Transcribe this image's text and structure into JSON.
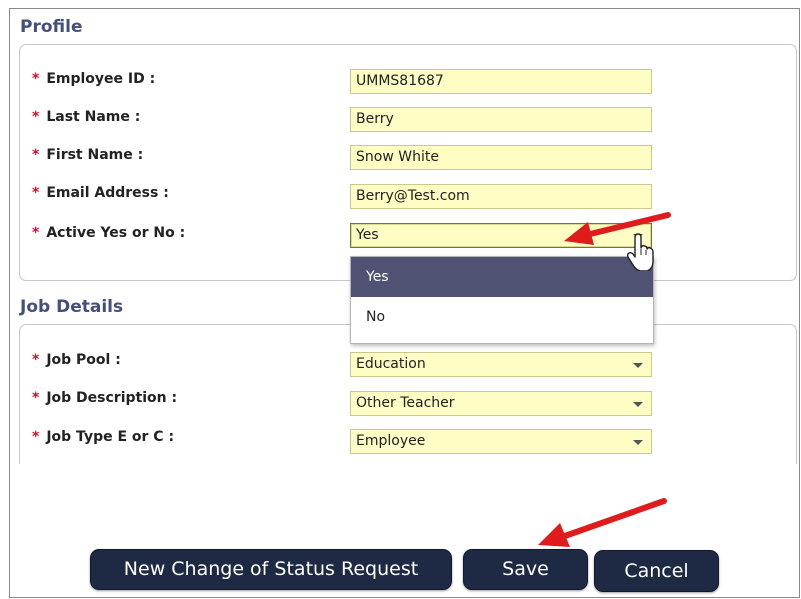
{
  "profile": {
    "title": "Profile",
    "required_mark": "*",
    "fields": [
      {
        "label": "Employee ID :",
        "value": "UMMS81687"
      },
      {
        "label": "Last Name :",
        "value": "Berry"
      },
      {
        "label": "First Name :",
        "value": "Snow White"
      },
      {
        "label": "Email Address :",
        "value": "Berry@Test.com"
      },
      {
        "label": "Active Yes or No :",
        "value": "Yes"
      }
    ],
    "active_options": [
      "Yes",
      "No"
    ],
    "active_selected": "Yes"
  },
  "job_details": {
    "title": "Job Details",
    "fields": [
      {
        "label": "Job Pool :",
        "value": "Education"
      },
      {
        "label": "Job Description :",
        "value": "Other Teacher"
      },
      {
        "label": "Job Type E or C :",
        "value": "Employee"
      }
    ]
  },
  "buttons": {
    "new_request": "New Change of Status Request",
    "save": "Save",
    "cancel": "Cancel"
  },
  "colors": {
    "section_title": "#44507a",
    "required": "#c8102e",
    "field_bg": "#fdfdc4",
    "selected_option": "#505273",
    "button_bg": "#1e2a44",
    "annotation_arrow": "#e01b1b"
  },
  "icons": {
    "cursor": "hand-pointer-icon",
    "annotation": "red-arrow-icon"
  }
}
